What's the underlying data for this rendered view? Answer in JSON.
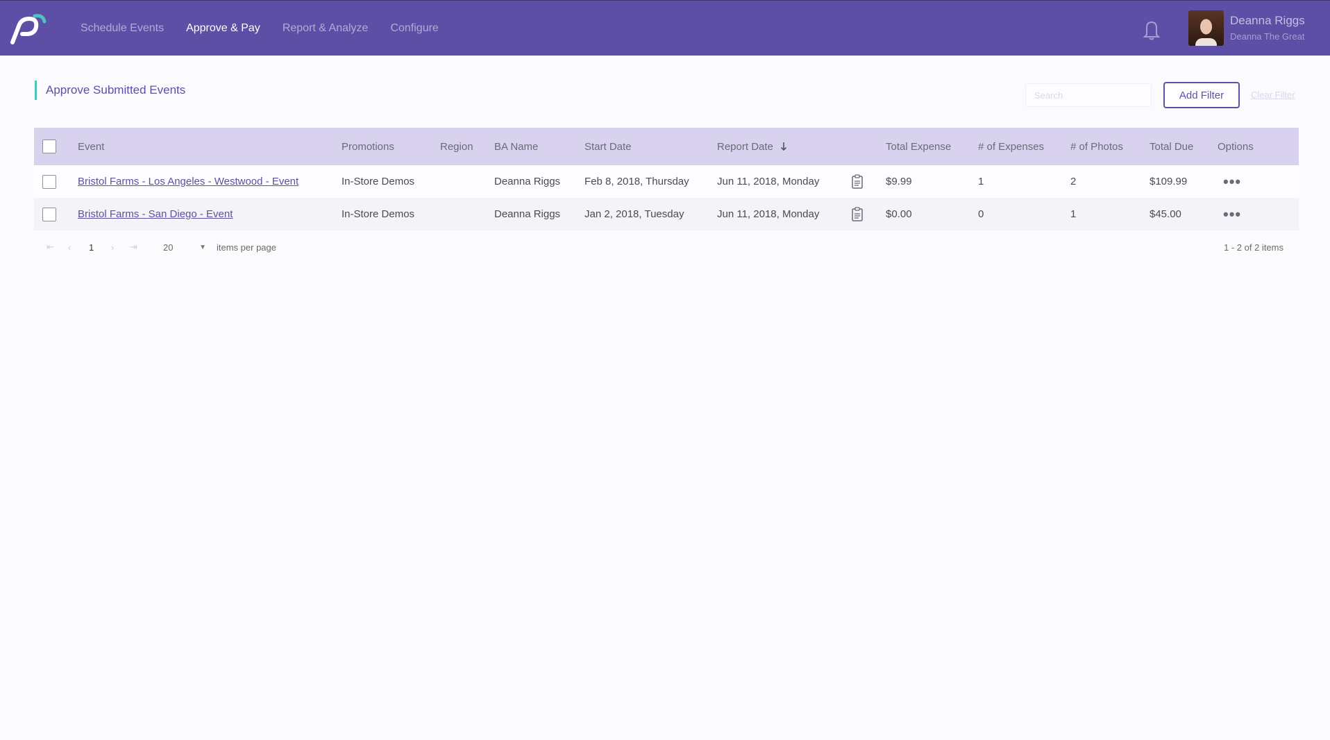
{
  "colors": {
    "primary": "#5d4fa6",
    "accent": "#4fc3c0",
    "header_row": "#d8d2ef"
  },
  "nav": {
    "items": [
      {
        "label": "Schedule Events",
        "active": false
      },
      {
        "label": "Approve & Pay",
        "active": true
      },
      {
        "label": "Report & Analyze",
        "active": false
      },
      {
        "label": "Configure",
        "active": false
      }
    ]
  },
  "user": {
    "name": "Deanna Riggs",
    "subtitle": "Deanna The Great"
  },
  "page": {
    "title": "Approve Submitted Events",
    "search_placeholder": "Search",
    "add_filter_label": "Add Filter",
    "clear_filter_label": "Clear Filter"
  },
  "table": {
    "headers": {
      "event": "Event",
      "promotions": "Promotions",
      "region": "Region",
      "ba_name": "BA Name",
      "start_date": "Start Date",
      "report_date": "Report Date",
      "total_expense": "Total Expense",
      "num_expenses": "# of Expenses",
      "num_photos": "# of Photos",
      "total_due": "Total Due",
      "options": "Options"
    },
    "rows": [
      {
        "event": "Bristol Farms - Los Angeles - Westwood - Event",
        "promotions": "In-Store Demos",
        "region": "",
        "ba_name": "Deanna Riggs",
        "start_date": "Feb 8, 2018, Thursday",
        "report_date": "Jun 11, 2018, Monday",
        "total_expense": "$9.99",
        "num_expenses": "1",
        "num_photos": "2",
        "total_due": "$109.99"
      },
      {
        "event": "Bristol Farms - San Diego - Event",
        "promotions": "In-Store Demos",
        "region": "",
        "ba_name": "Deanna Riggs",
        "start_date": "Jan 2, 2018, Tuesday",
        "report_date": "Jun 11, 2018, Monday",
        "total_expense": "$0.00",
        "num_expenses": "0",
        "num_photos": "1",
        "total_due": "$45.00"
      }
    ]
  },
  "pager": {
    "first": "⇤",
    "prev": "‹",
    "current_page": "1",
    "next": "›",
    "last": "⇥",
    "per_page": "20",
    "per_page_label": "items per page",
    "info": "1 - 2 of 2 items"
  }
}
